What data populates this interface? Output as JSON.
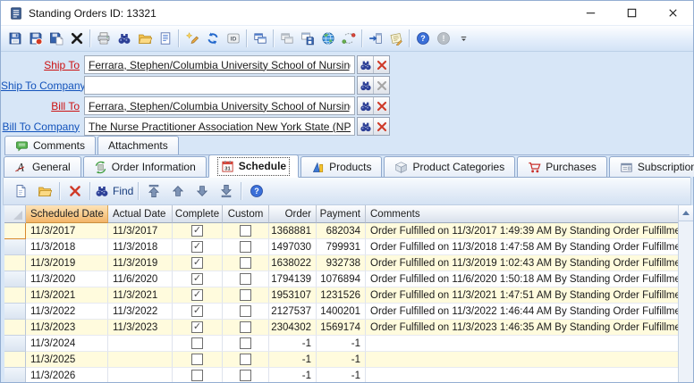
{
  "window": {
    "title": "Standing Orders ID: 13321"
  },
  "toolbar": {
    "items": [
      {
        "icon": "floppy",
        "name": "save"
      },
      {
        "icon": "floppy-red",
        "name": "save-and-close"
      },
      {
        "icon": "floppy-page",
        "name": "save-and-new"
      },
      {
        "icon": "xblack",
        "name": "delete"
      },
      "|",
      {
        "icon": "print",
        "name": "print"
      },
      {
        "icon": "binoculars",
        "name": "find"
      },
      {
        "icon": "folder",
        "name": "open"
      },
      {
        "icon": "doc",
        "name": "preview-report"
      },
      "|",
      {
        "icon": "penstar",
        "name": "new-edit"
      },
      {
        "icon": "refresh",
        "name": "refresh"
      },
      {
        "icon": "idbox",
        "name": "copy-id"
      },
      "|",
      {
        "icon": "window2",
        "name": "open-in-window"
      },
      "|",
      {
        "icon": "windows-grey",
        "name": "windows",
        "disabled": true
      },
      {
        "icon": "floppy-win",
        "name": "save-layout"
      },
      {
        "icon": "globe",
        "name": "web"
      },
      {
        "icon": "sync",
        "name": "sync"
      },
      "|",
      {
        "icon": "export",
        "name": "export"
      },
      {
        "icon": "note",
        "name": "notes"
      },
      "|",
      {
        "icon": "help",
        "name": "help"
      },
      {
        "icon": "alert",
        "name": "alert",
        "disabled": true
      },
      {
        "icon": "overflow",
        "name": "toolbar-overflow"
      }
    ]
  },
  "form": {
    "fields": [
      {
        "label": "Ship To",
        "value": "Ferrara, Stephen/Columbia University School of Nursing",
        "required": true,
        "clear_enabled": true
      },
      {
        "label": "Ship To Company",
        "value": "",
        "required": false,
        "clear_enabled": false
      },
      {
        "label": "Bill To",
        "value": "Ferrara, Stephen/Columbia University School of Nursing",
        "required": true,
        "clear_enabled": true
      },
      {
        "label": "Bill To Company",
        "value": "The Nurse Practitioner Association New York State (NPANY",
        "required": false,
        "clear_enabled": true
      }
    ]
  },
  "upper_tabs": [
    {
      "label": "Comments",
      "icon": "comment"
    },
    {
      "label": "Attachments"
    }
  ],
  "main_tabs": [
    {
      "label": "General",
      "icon": "general"
    },
    {
      "label": "Order Information",
      "icon": "orderinfo"
    },
    {
      "label": "Schedule",
      "icon": "calendar",
      "selected": true
    },
    {
      "label": "Products",
      "icon": "products"
    },
    {
      "label": "Product Categories",
      "icon": "category"
    },
    {
      "label": "Purchases",
      "icon": "cart"
    },
    {
      "label": "Subscriptions",
      "icon": "subs"
    }
  ],
  "grid_toolbar": {
    "items": [
      {
        "icon": "newdoc",
        "name": "new-row"
      },
      {
        "icon": "folder",
        "name": "open-row"
      },
      "|",
      {
        "icon": "xred",
        "name": "delete-row"
      },
      "|",
      {
        "icon": "binoculars",
        "name": "find",
        "label": "Find"
      },
      "|",
      {
        "icon": "arrtop",
        "name": "move-first"
      },
      {
        "icon": "arrup",
        "name": "move-up"
      },
      {
        "icon": "arrdown",
        "name": "move-down"
      },
      {
        "icon": "arrbottom",
        "name": "move-last"
      },
      "|",
      {
        "icon": "help",
        "name": "help"
      }
    ]
  },
  "grid": {
    "columns": [
      "Scheduled Date",
      "Actual Date",
      "Complete",
      "Custom",
      "Order",
      "Payment",
      "Comments"
    ],
    "sorted_column": "Scheduled Date",
    "rows": [
      {
        "scheduled_date": "11/3/2017",
        "actual_date": "11/3/2017",
        "complete": true,
        "custom": false,
        "order": "1368881",
        "payment": "682034",
        "comments": "Order Fulfilled on 11/3/2017 1:49:39 AM By Standing Order Fulfillme",
        "current": true
      },
      {
        "scheduled_date": "11/3/2018",
        "actual_date": "11/3/2018",
        "complete": true,
        "custom": false,
        "order": "1497030",
        "payment": "799931",
        "comments": "Order Fulfilled on 11/3/2018 1:47:58 AM By Standing Order Fulfillme"
      },
      {
        "scheduled_date": "11/3/2019",
        "actual_date": "11/3/2019",
        "complete": true,
        "custom": false,
        "order": "1638022",
        "payment": "932738",
        "comments": "Order Fulfilled on 11/3/2019 1:02:43 AM By Standing Order Fulfillme"
      },
      {
        "scheduled_date": "11/3/2020",
        "actual_date": "11/6/2020",
        "complete": true,
        "custom": false,
        "order": "1794139",
        "payment": "1076894",
        "comments": "Order Fulfilled on 11/6/2020 1:50:18 AM By Standing Order Fulfillme"
      },
      {
        "scheduled_date": "11/3/2021",
        "actual_date": "11/3/2021",
        "complete": true,
        "custom": false,
        "order": "1953107",
        "payment": "1231526",
        "comments": "Order Fulfilled on 11/3/2021 1:47:51 AM By Standing Order Fulfillme"
      },
      {
        "scheduled_date": "11/3/2022",
        "actual_date": "11/3/2022",
        "complete": true,
        "custom": false,
        "order": "2127537",
        "payment": "1400201",
        "comments": "Order Fulfilled on 11/3/2022 1:46:44 AM By Standing Order Fulfillme"
      },
      {
        "scheduled_date": "11/3/2023",
        "actual_date": "11/3/2023",
        "complete": true,
        "custom": false,
        "order": "2304302",
        "payment": "1569174",
        "comments": "Order Fulfilled on 11/3/2023 1:46:35 AM By Standing Order Fulfillme"
      },
      {
        "scheduled_date": "11/3/2024",
        "actual_date": "",
        "complete": false,
        "custom": false,
        "order": "-1",
        "payment": "-1",
        "comments": ""
      },
      {
        "scheduled_date": "11/3/2025",
        "actual_date": "",
        "complete": false,
        "custom": false,
        "order": "-1",
        "payment": "-1",
        "comments": ""
      },
      {
        "scheduled_date": "11/3/2026",
        "actual_date": "",
        "complete": false,
        "custom": false,
        "order": "-1",
        "payment": "-1",
        "comments": ""
      }
    ]
  },
  "colors": {
    "window_bg": "#d7e6f7",
    "sorted_header": "#f2b469",
    "zebra_row": "#fffbdd",
    "current_row_selector": "#f6a94e",
    "required_label": "#cc1111",
    "link_label": "#1353bb"
  }
}
